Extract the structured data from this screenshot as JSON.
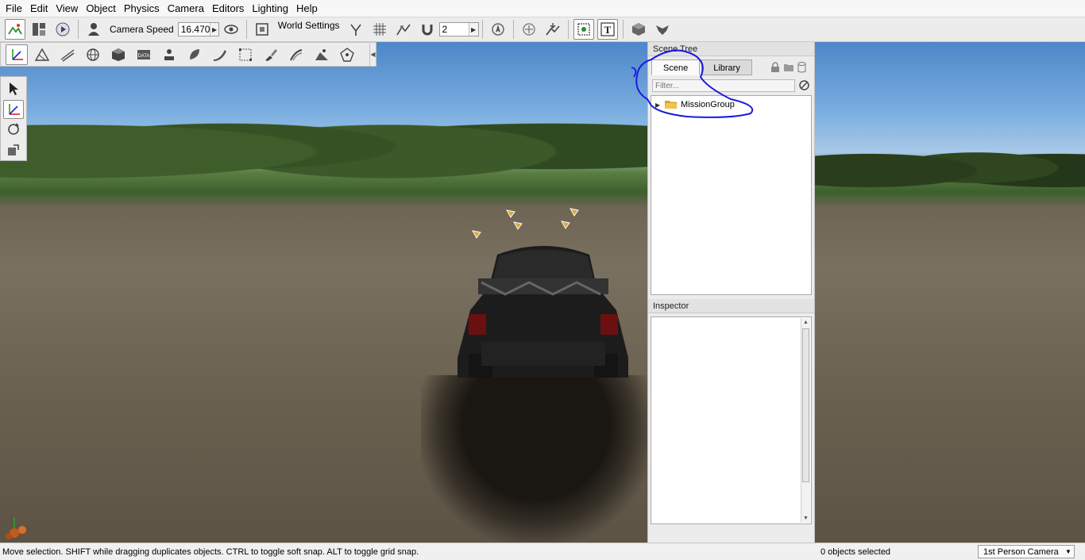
{
  "menu": [
    "File",
    "Edit",
    "View",
    "Object",
    "Physics",
    "Camera",
    "Editors",
    "Lighting",
    "Help"
  ],
  "toolbar": {
    "camera_speed_label": "Camera Speed",
    "camera_speed_value": "16.470",
    "world_settings_label": "World Settings",
    "snap_value": "2"
  },
  "scene_tree": {
    "title": "Scene Tree",
    "tabs": [
      "Scene",
      "Library"
    ],
    "filter_placeholder": "Filter...",
    "root_item": "MissionGroup"
  },
  "inspector": {
    "title": "Inspector"
  },
  "status": {
    "message": "Move selection.  SHIFT while dragging duplicates objects.  CTRL to toggle soft snap.  ALT to toggle grid snap.",
    "selection_count": "0 objects selected",
    "camera_mode": "1st Person Camera"
  },
  "colors": {
    "annotation": "#1a1ae0"
  }
}
